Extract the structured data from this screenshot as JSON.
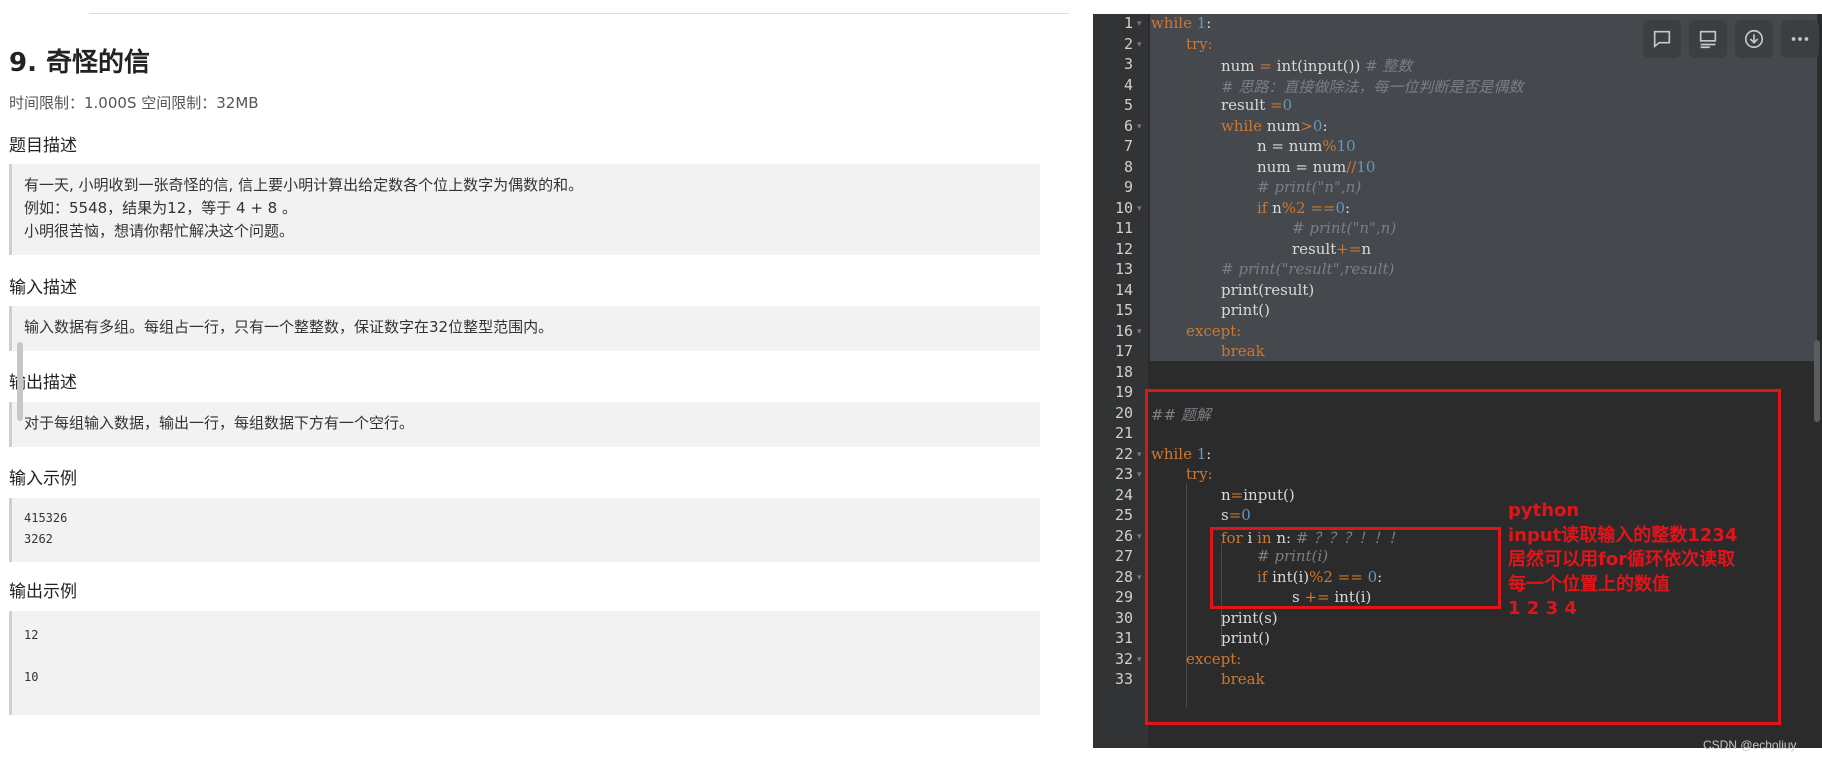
{
  "problem": {
    "title": "9. 奇怪的信",
    "limits": "时间限制：1.000S  空间限制：32MB",
    "sections": [
      {
        "heading": "题目描述",
        "lines": [
          "有一天, 小明收到一张奇怪的信, 信上要小明计算出给定数各个位上数字为偶数的和。",
          "例如：5548，结果为12，等于 4 + 8 。",
          "小明很苦恼，想请你帮忙解决这个问题。"
        ]
      },
      {
        "heading": "输入描述",
        "lines": [
          "输入数据有多组。每组占一行，只有一个整整数，保证数字在32位整型范围内。"
        ]
      },
      {
        "heading": "输出描述",
        "lines": [
          "对于每组输入数据，输出一行，每组数据下方有一个空行。"
        ]
      },
      {
        "heading": "输入示例",
        "lines": [
          "415326",
          "3262"
        ]
      },
      {
        "heading": "输出示例",
        "lines": [
          "12",
          "",
          "10"
        ]
      }
    ]
  },
  "editor": {
    "line_numbers": [
      "1",
      "2",
      "3",
      "4",
      "5",
      "6",
      "7",
      "8",
      "9",
      "10",
      "11",
      "12",
      "13",
      "14",
      "15",
      "16",
      "17",
      "18",
      "19",
      "20",
      "21",
      "22",
      "23",
      "24",
      "25",
      "26",
      "27",
      "28",
      "29",
      "30",
      "31",
      "32",
      "33"
    ],
    "code": {
      "l1_kw": "while",
      "l1_num": " 1",
      "l1_rest": ":",
      "l2": "try:",
      "l3_a": "num ",
      "l3_b": "= ",
      "l3_c": "int(input()) ",
      "l3_cm": "# 整数",
      "l4_cm": "# 思路：直接做除法，每一位判断是否是偶数",
      "l5_a": "result ",
      "l5_b": "=",
      "l5_c": "0",
      "l6_kw": "while",
      "l6_a": " num",
      "l6_b": ">",
      "l6_c": "0",
      "l6_d": ":",
      "l7_a": "n = num",
      "l7_b": "%",
      "l7_c": "10",
      "l8_a": "num = num",
      "l8_b": "//",
      "l8_c": "10",
      "l9_cm": "# print(\"n\",n)",
      "l10_kw": "if",
      "l10_a": " n",
      "l10_b": "%2 ==",
      "l10_c": "0",
      "l10_d": ":",
      "l11_cm": "# print(\"n\",n)",
      "l12_a": "result",
      "l12_b": "+=",
      "l12_c": "n",
      "l13_cm": "# print(\"result\",result)",
      "l14": "print(result)",
      "l15": "print()",
      "l16": "except:",
      "l17": "break",
      "l20_cm": "## 题解",
      "l22_kw": "while",
      "l22_num": " 1",
      "l22_rest": ":",
      "l23": "try:",
      "l24_a": "n",
      "l24_b": "=",
      "l24_c": "input()",
      "l25_a": "s",
      "l25_b": "=",
      "l25_c": "0",
      "l26_kw": "for",
      "l26_a": " i ",
      "l26_kw2": "in",
      "l26_b": " n: ",
      "l26_cm": "# ？？？！！！",
      "l27_cm": "# print(i)",
      "l28_kw": "if",
      "l28_a": " int(i)",
      "l28_b": "%2 == ",
      "l28_c": "0",
      "l28_d": ":",
      "l29_a": "s ",
      "l29_b": "+= ",
      "l29_c": "int(i)",
      "l30": "print(s)",
      "l31": "print()",
      "l32": "except:",
      "l33": "break"
    }
  },
  "annotation": {
    "lines": [
      "python",
      "input读取输入的整数1234",
      "居然可以用for循环依次读取",
      "每一个位置上的数值",
      "1 2 3 4"
    ]
  },
  "toolbar": {
    "icons": [
      "comment-icon",
      "outline-icon",
      "download-icon",
      "more-icon"
    ]
  },
  "watermark": "CSDN @echoliuy",
  "colors": {
    "keyword": "#cc7832",
    "number": "#6897bb",
    "comment": "#7a7e85",
    "annotation_red": "#e0151b",
    "editor_bg": "#2b2b2b"
  }
}
